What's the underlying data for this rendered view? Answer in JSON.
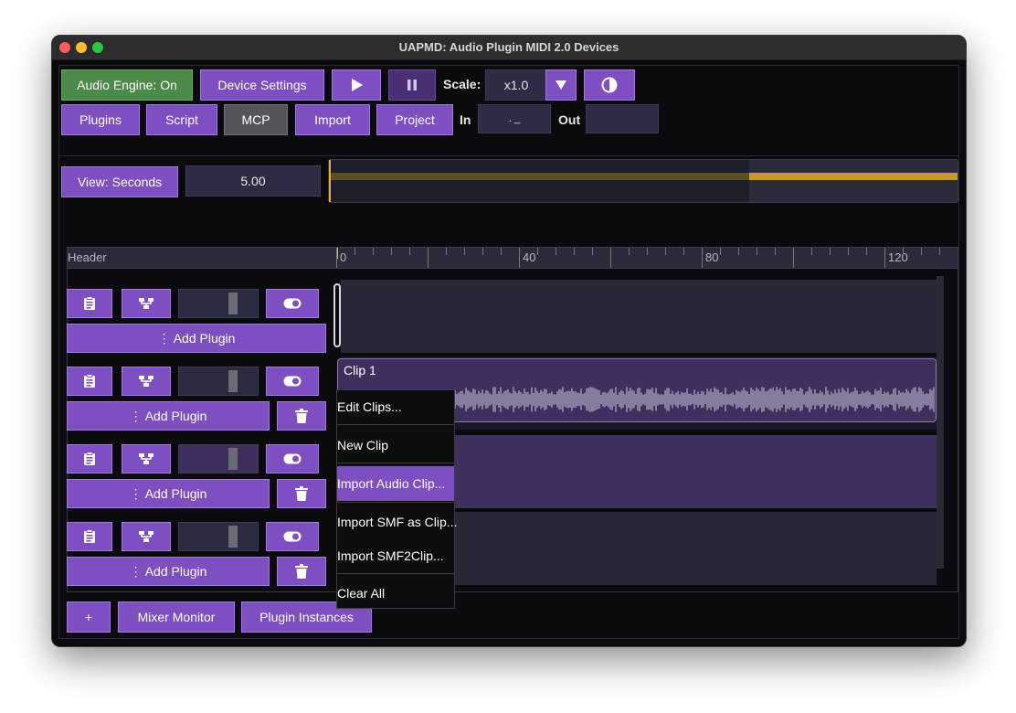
{
  "window": {
    "title": "UAPMD: Audio Plugin MIDI 2.0 Devices"
  },
  "toolbar": {
    "audio_engine": "Audio Engine: On",
    "device_settings": "Device Settings",
    "scale_label": "Scale:",
    "scale_value": "x1.0",
    "plugins": "Plugins",
    "script": "Script",
    "mcp": "MCP",
    "import": "Import",
    "project": "Project",
    "in_label": "In",
    "in_value": ". _",
    "out_label": "Out",
    "out_value": ""
  },
  "view": {
    "mode": "View: Seconds",
    "value": "5.00"
  },
  "ruler": {
    "header": "Header",
    "labels": [
      "0",
      "40",
      "80",
      "120"
    ]
  },
  "tracks": [
    {
      "add_plugin": "⋮ Add Plugin"
    },
    {
      "add_plugin": "⋮ Add Plugin",
      "clip": "Clip 1"
    },
    {
      "add_plugin": "⋮ Add Plugin"
    },
    {
      "add_plugin": "⋮ Add Plugin"
    }
  ],
  "context_menu": {
    "items": [
      "Edit Clips...",
      "New Clip",
      "Import Audio Clip...",
      "Import SMF as Clip...",
      "Import SMF2Clip...",
      "Clear All"
    ],
    "highlighted": "Import Audio Clip..."
  },
  "footer": {
    "add": "+",
    "mixer_monitor": "Mixer Monitor",
    "plugin_instances": "Plugin Instances"
  },
  "colors": {
    "accent": "#7e4fc0",
    "engine_on": "#4c8a4a",
    "overview_bar": "#c79a2a",
    "background": "#0b0b0f"
  }
}
